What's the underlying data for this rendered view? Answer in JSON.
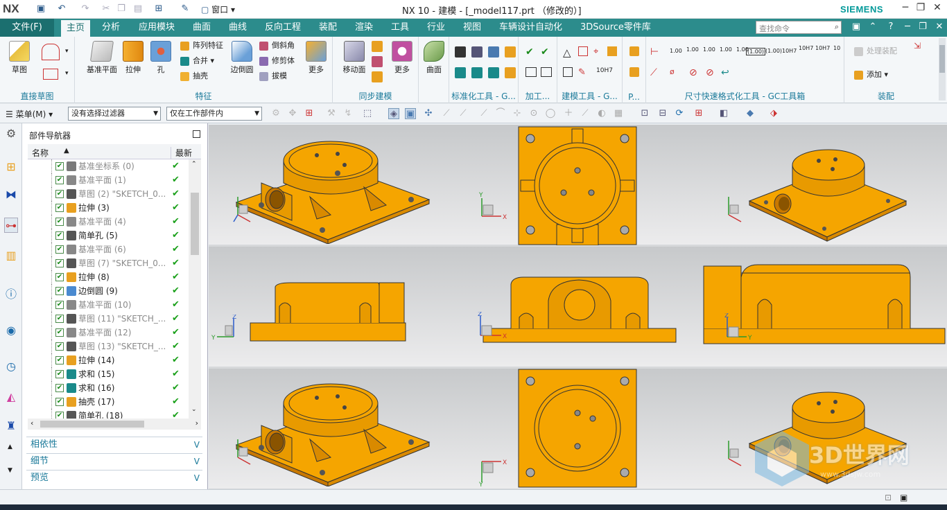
{
  "app": {
    "logo": "NX",
    "title": "NX 10 - 建模 - [_model117.prt （修改的）]",
    "brand": "SIEMENS",
    "window_menu": "窗口",
    "window_menu_arrow": "▾"
  },
  "menubar": {
    "file": "文件(F)",
    "tabs": [
      "主页",
      "分析",
      "应用模块",
      "曲面",
      "曲线",
      "反向工程",
      "装配",
      "渲染",
      "工具",
      "行业",
      "视图",
      "车辆设计自动化",
      "3DSource零件库"
    ],
    "active_tab": "主页",
    "search_placeholder": "查找命令"
  },
  "ribbon": {
    "sketch_group": {
      "label": "直接草图",
      "sketch": "草图"
    },
    "feature_group": {
      "label": "特征",
      "datum_plane": "基准平面",
      "extrude": "拉伸",
      "hole": "孔",
      "pattern": "阵列特征",
      "unite": "合并",
      "shell": "抽壳",
      "edge_blend": "边倒圆",
      "chamfer": "倒斜角",
      "trim_body": "修剪体",
      "draft": "拔模",
      "more": "更多"
    },
    "sync_group": {
      "label": "同步建模",
      "move_face": "移动面",
      "more": "更多"
    },
    "surface_group": {
      "label": "",
      "surface": "曲面"
    },
    "std_group": {
      "label": "标准化工具 - G..."
    },
    "machining_group": {
      "label": "加工..."
    },
    "build_group": {
      "label": "建模工具 - G..."
    },
    "p_group": {
      "label": "P..."
    },
    "dim_group": {
      "label": "尺寸快速格式化工具 - GC工具箱",
      "values": [
        "1.00",
        "1.00",
        "1.00",
        "1.00",
        "1.00",
        "(1.00)",
        "10H7",
        "10H7",
        "10H7",
        "10"
      ]
    },
    "assembly_group": {
      "label": "装配",
      "process": "处理装配",
      "add": "添加"
    }
  },
  "toolbar2": {
    "menu": "菜单(M)",
    "filter": "没有选择过滤器",
    "scope": "仅在工作部件内"
  },
  "navigator": {
    "title": "部件导航器",
    "col_name": "名称",
    "col_sort_arrow": "▲",
    "col_latest": "最新",
    "items": [
      {
        "label": "基准坐标系 (0)",
        "dim": true,
        "icon": "csys-icon",
        "color": "#7a7a7a"
      },
      {
        "label": "基准平面 (1)",
        "dim": true,
        "icon": "plane-icon",
        "color": "#888"
      },
      {
        "label": "草图 (2) \"SKETCH_0...",
        "dim": true,
        "icon": "sketch-icon",
        "color": "#555"
      },
      {
        "label": "拉伸 (3)",
        "dim": false,
        "icon": "extrude-icon",
        "color": "#e8a020"
      },
      {
        "label": "基准平面 (4)",
        "dim": true,
        "icon": "plane-icon",
        "color": "#888"
      },
      {
        "label": "简单孔 (5)",
        "dim": false,
        "icon": "hole-icon",
        "color": "#555"
      },
      {
        "label": "基准平面 (6)",
        "dim": true,
        "icon": "plane-icon",
        "color": "#888"
      },
      {
        "label": "草图 (7) \"SKETCH_0...",
        "dim": true,
        "icon": "sketch-icon",
        "color": "#555"
      },
      {
        "label": "拉伸 (8)",
        "dim": false,
        "icon": "extrude-icon",
        "color": "#e8a020"
      },
      {
        "label": "边倒圆 (9)",
        "dim": false,
        "icon": "blend-icon",
        "color": "#4a8ad0"
      },
      {
        "label": "基准平面 (10)",
        "dim": true,
        "icon": "plane-icon",
        "color": "#888"
      },
      {
        "label": "草图 (11) \"SKETCH_...",
        "dim": true,
        "icon": "sketch-icon",
        "color": "#555"
      },
      {
        "label": "基准平面 (12)",
        "dim": true,
        "icon": "plane-icon",
        "color": "#888"
      },
      {
        "label": "草图 (13) \"SKETCH_...",
        "dim": true,
        "icon": "sketch-icon",
        "color": "#555"
      },
      {
        "label": "拉伸 (14)",
        "dim": false,
        "icon": "extrude-icon",
        "color": "#e8a020"
      },
      {
        "label": "求和 (15)",
        "dim": false,
        "icon": "unite-icon",
        "color": "#1a8a8a"
      },
      {
        "label": "求和 (16)",
        "dim": false,
        "icon": "unite-icon",
        "color": "#1a8a8a"
      },
      {
        "label": "抽壳 (17)",
        "dim": false,
        "icon": "shell-icon",
        "color": "#e8a020"
      },
      {
        "label": "简单孔 (18)",
        "dim": false,
        "icon": "hole-icon",
        "color": "#555"
      }
    ],
    "panels": [
      "相依性",
      "细节",
      "预览"
    ]
  },
  "viewport": {
    "axis_x": "X",
    "axis_y": "Y",
    "axis_z": "Z",
    "model_color": "#f5a500",
    "model_dark": "#c87800",
    "bg_top": "#c7c9cb",
    "bg_bottom": "#ececed"
  },
  "watermark": {
    "text": "3D世界网",
    "sub": "www.3dsjw.com"
  },
  "colors": {
    "accent": "#2c8c8c",
    "menu_dark": "#1b6f6f",
    "link": "#1b7a9a",
    "check": "#1aa01a"
  }
}
